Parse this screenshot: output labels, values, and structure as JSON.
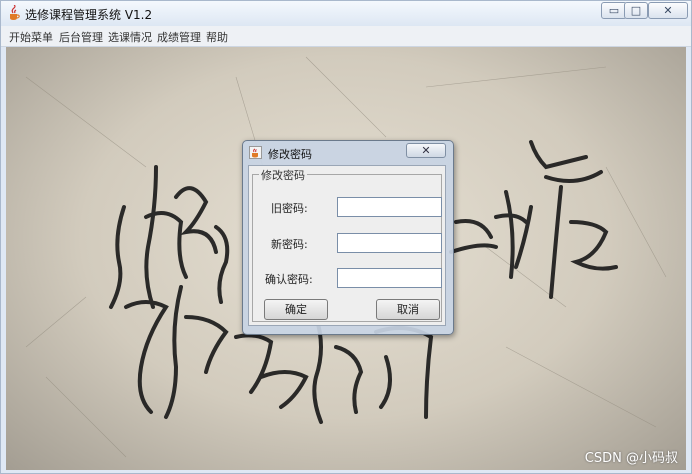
{
  "window": {
    "title": "选修课程管理系统 V1.2",
    "controls": {
      "minimize": "▭",
      "maximize": "□",
      "close": "✕"
    }
  },
  "menubar": {
    "items": [
      {
        "label": "开始菜单"
      },
      {
        "label": "后台管理"
      },
      {
        "label": "选课情况"
      },
      {
        "label": "成绩管理"
      },
      {
        "label": "帮助"
      }
    ]
  },
  "background": {
    "watermark": "CSDN @小码叔"
  },
  "dialog": {
    "title": "修改密码",
    "close_label": "✕",
    "group_label": "修改密码",
    "old_password_label": "旧密码:",
    "old_password_value": "",
    "new_password_label": "新密码:",
    "new_password_value": "",
    "confirm_password_label": "确认密码:",
    "confirm_password_value": "",
    "ok_label": "确定",
    "cancel_label": "取消"
  },
  "colors": {
    "accent": "#dfe8f4",
    "window_border": "#a9b8cc"
  }
}
